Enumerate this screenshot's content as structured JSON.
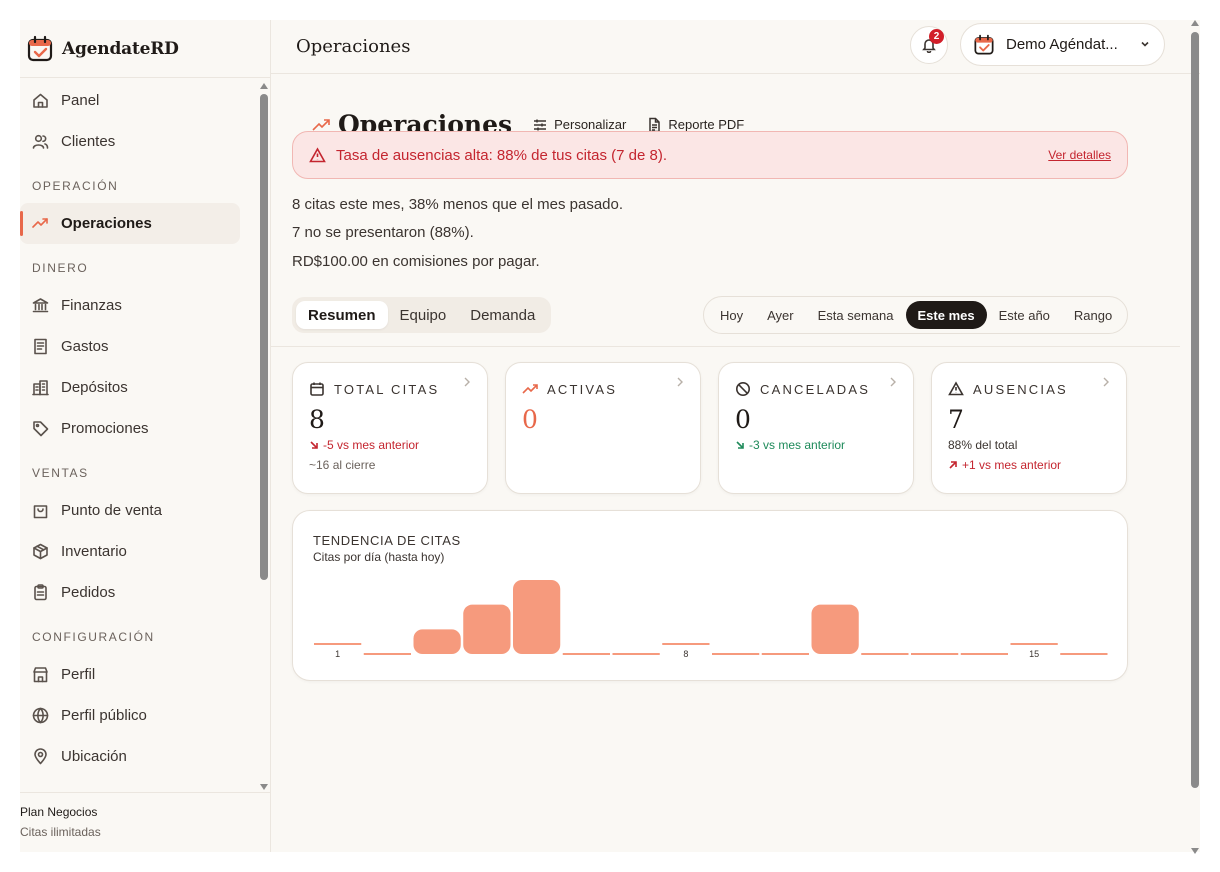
{
  "brand": {
    "name": "AgendateRD"
  },
  "sidebar": {
    "items": [
      {
        "type": "item",
        "label": "Panel",
        "icon": "home-icon"
      },
      {
        "type": "item",
        "label": "Clientes",
        "icon": "users-icon"
      },
      {
        "type": "section",
        "label": "OPERACIÓN"
      },
      {
        "type": "item",
        "label": "Operaciones",
        "icon": "trending-up-icon",
        "active": true
      },
      {
        "type": "section",
        "label": "DINERO"
      },
      {
        "type": "item",
        "label": "Finanzas",
        "icon": "bank-icon"
      },
      {
        "type": "item",
        "label": "Gastos",
        "icon": "receipt-icon"
      },
      {
        "type": "item",
        "label": "Depósitos",
        "icon": "building-icon"
      },
      {
        "type": "item",
        "label": "Promociones",
        "icon": "tag-icon"
      },
      {
        "type": "section",
        "label": "VENTAS"
      },
      {
        "type": "item",
        "label": "Punto de venta",
        "icon": "shopping-bag-icon"
      },
      {
        "type": "item",
        "label": "Inventario",
        "icon": "package-icon"
      },
      {
        "type": "item",
        "label": "Pedidos",
        "icon": "clipboard-icon"
      },
      {
        "type": "section",
        "label": "CONFIGURACIÓN"
      },
      {
        "type": "item",
        "label": "Perfil",
        "icon": "store-icon"
      },
      {
        "type": "item",
        "label": "Perfil público",
        "icon": "globe-icon"
      },
      {
        "type": "item",
        "label": "Ubicación",
        "icon": "map-pin-icon"
      }
    ],
    "plan": {
      "name": "Plan Negocios",
      "detail": "Citas ilimitadas"
    }
  },
  "header": {
    "title": "Operaciones",
    "notifications": "2",
    "account_name": "Demo Agéndat..."
  },
  "page": {
    "title": "Operaciones",
    "customize_label": "Personalizar",
    "report_label": "Reporte PDF",
    "alert": {
      "text": "Tasa de ausencias alta: 88% de tus citas (7 de 8).",
      "link": "Ver detalles"
    },
    "summary": [
      "8 citas este mes, 38% menos que el mes pasado.",
      "7 no se presentaron (88%).",
      "RD$100.00 en comisiones por pagar."
    ],
    "tabs": [
      {
        "label": "Resumen",
        "active": true
      },
      {
        "label": "Equipo",
        "active": false
      },
      {
        "label": "Demanda",
        "active": false
      }
    ],
    "ranges": [
      {
        "label": "Hoy",
        "active": false
      },
      {
        "label": "Ayer",
        "active": false
      },
      {
        "label": "Esta semana",
        "active": false
      },
      {
        "label": "Este mes",
        "active": true
      },
      {
        "label": "Este año",
        "active": false
      },
      {
        "label": "Rango",
        "active": false
      }
    ]
  },
  "cards": [
    {
      "label": "TOTAL CITAS",
      "value": "8",
      "delta": "-5 vs mes anterior",
      "delta_color": "red",
      "sub": "~16 al cierre"
    },
    {
      "label": "ACTIVAS",
      "value": "0"
    },
    {
      "label": "CANCELADAS",
      "value": "0",
      "delta": "-3 vs mes anterior",
      "delta_color": "green"
    },
    {
      "label": "AUSENCIAS",
      "value": "7",
      "sub_first": "88% del total",
      "delta": "+1 vs mes anterior",
      "delta_color": "red"
    }
  ],
  "colors": {
    "accent": "#e8684a",
    "bar": "#f69a7d",
    "danger": "#c4252f",
    "success": "#1e8a5a"
  },
  "chart_data": {
    "type": "bar",
    "title": "TENDENCIA DE CITAS",
    "subtitle": "Citas por día (hasta hoy)",
    "categories": [
      "1",
      "2",
      "3",
      "4",
      "5",
      "6",
      "7",
      "8",
      "9",
      "10",
      "11",
      "12",
      "13",
      "14",
      "15",
      "16"
    ],
    "tick_labels_shown": [
      "1",
      "8",
      "15"
    ],
    "values": [
      0,
      0,
      1,
      2,
      3,
      0,
      0,
      0,
      0,
      0,
      2,
      0,
      0,
      0,
      0,
      0
    ],
    "ylim": [
      0,
      3
    ]
  }
}
